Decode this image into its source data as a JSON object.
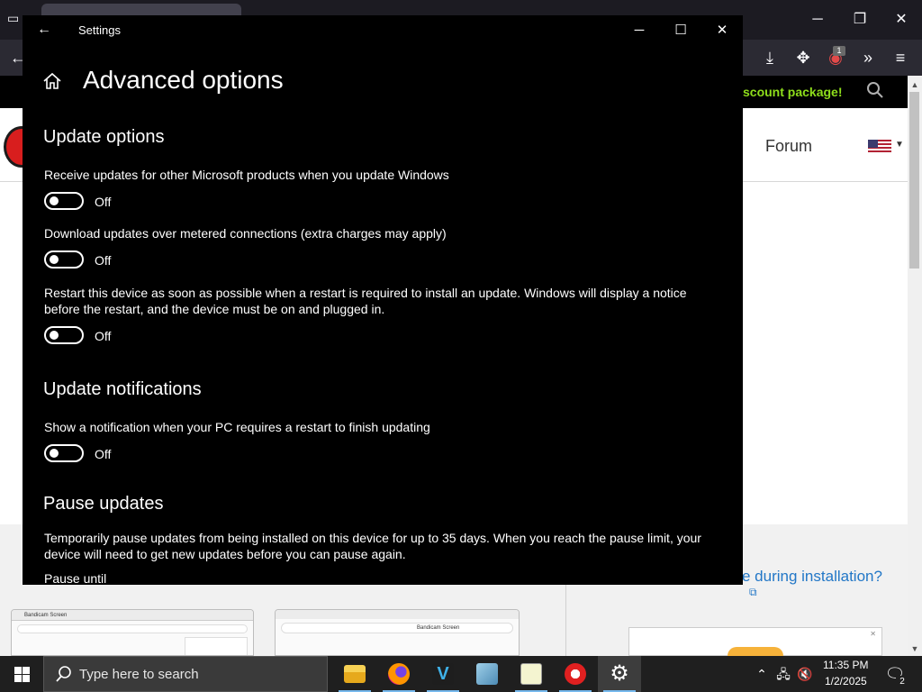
{
  "browser": {
    "promo_text": "scount package!",
    "forum_link": "Forum",
    "installation_link": "e during installation?",
    "ublock_count": "1",
    "thumbnail_tab_left": "Bandicam Screen",
    "thumbnail_tab_right": "Bandicam Screen"
  },
  "settings": {
    "window_title": "Settings",
    "page_title": "Advanced options",
    "sections": [
      {
        "heading": "Update options",
        "items": [
          {
            "label": "Receive updates for other Microsoft products when you update Windows",
            "state": "Off"
          },
          {
            "label": "Download updates over metered connections (extra charges may apply)",
            "state": "Off"
          },
          {
            "label": "Restart this device as soon as possible when a restart is required to install an update. Windows will display a notice before the restart, and the device must be on and plugged in.",
            "state": "Off"
          }
        ]
      },
      {
        "heading": "Update notifications",
        "items": [
          {
            "label": "Show a notification when your PC requires a restart to finish updating",
            "state": "Off"
          }
        ]
      },
      {
        "heading": "Pause updates",
        "description": "Temporarily pause updates from being installed on this device for up to 35 days. When you reach the pause limit, your device will need to get new updates before you can pause again.",
        "pause_until_label": "Pause until"
      }
    ]
  },
  "taskbar": {
    "search_placeholder": "Type here to search",
    "apps": [
      "file-explorer",
      "firefox",
      "visual-studio",
      "control-panel",
      "notepad-plus-plus",
      "bandicam",
      "settings"
    ],
    "clock_time": "11:35 PM",
    "clock_date": "1/2/2025",
    "notification_count": "2"
  },
  "colors": {
    "settings_bg": "#000000",
    "taskbar_bg": "#1f1f1f",
    "promo_green": "#8edd1b",
    "link_blue": "#2277c7"
  }
}
